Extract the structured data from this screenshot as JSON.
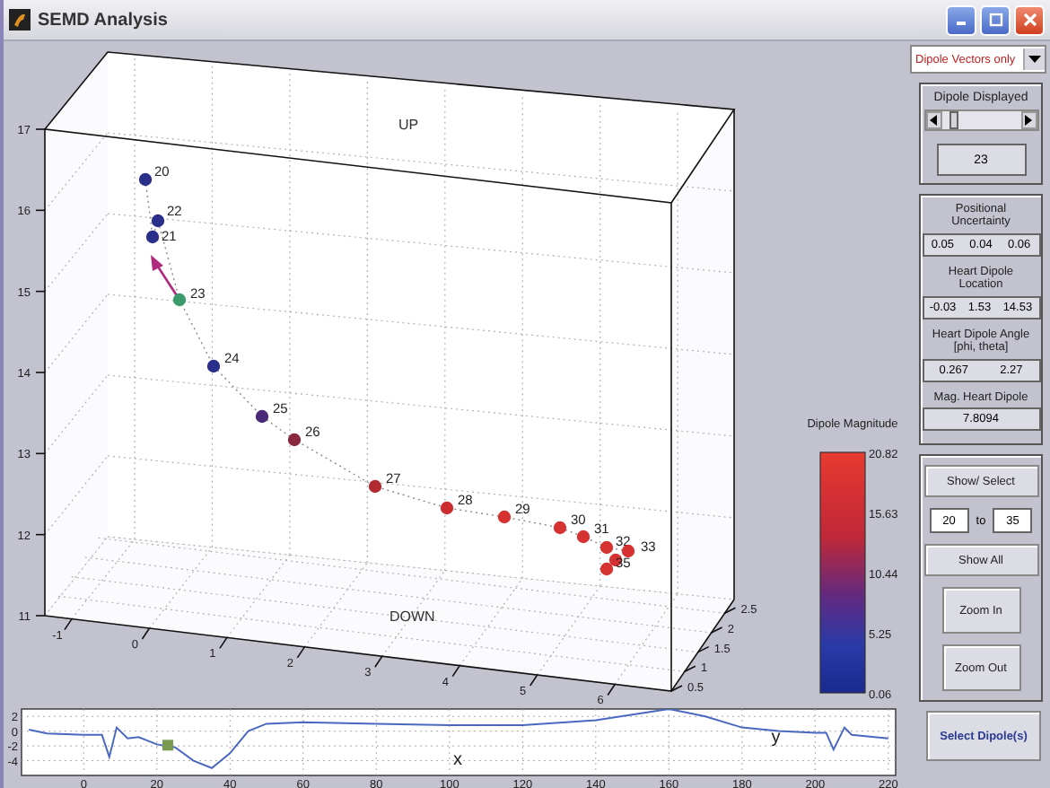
{
  "window": {
    "title": "SEMD Analysis"
  },
  "plot3d": {
    "top_label": "UP",
    "bottom_label": "DOWN",
    "z_ticks": [
      "17",
      "16",
      "15",
      "14",
      "13",
      "12",
      "11"
    ],
    "x_ticks": [
      "-1",
      "0",
      "1",
      "2",
      "3",
      "4",
      "5",
      "6"
    ],
    "y_ticks": [
      "2.5",
      "2",
      "1.5",
      "1",
      "0.5"
    ],
    "dipoles": [
      {
        "label": "20",
        "color": "#2b2f8c",
        "selected": false
      },
      {
        "label": "21",
        "color": "#2b2f8c",
        "selected": false
      },
      {
        "label": "22",
        "color": "#2b2f8c",
        "selected": false
      },
      {
        "label": "23",
        "color": "#3a9a6a",
        "selected": true
      },
      {
        "label": "24",
        "color": "#2b2f8c",
        "selected": false
      },
      {
        "label": "25",
        "color": "#4a2a78",
        "selected": false
      },
      {
        "label": "26",
        "color": "#8a2840",
        "selected": false
      },
      {
        "label": "27",
        "color": "#b02a30",
        "selected": false
      },
      {
        "label": "28",
        "color": "#cc2e30",
        "selected": false
      },
      {
        "label": "29",
        "color": "#d63232",
        "selected": false
      },
      {
        "label": "30",
        "color": "#d63232",
        "selected": false
      },
      {
        "label": "31",
        "color": "#d63232",
        "selected": false
      },
      {
        "label": "32",
        "color": "#d63232",
        "selected": false
      },
      {
        "label": "33",
        "color": "#d63232",
        "selected": false
      },
      {
        "color": "#d63232",
        "selected": false
      },
      {
        "label": "35",
        "color": "#d63232",
        "selected": false
      }
    ],
    "colorbar": {
      "title": "Dipole Magnitude",
      "ticks": [
        "20.82",
        "15.63",
        "10.44",
        "5.25",
        "0.06"
      ]
    }
  },
  "ecg": {
    "chart_data": {
      "type": "line",
      "x": [
        -15,
        -10,
        0,
        5,
        7,
        9,
        12,
        15,
        20,
        25,
        30,
        35,
        40,
        45,
        50,
        60,
        80,
        100,
        120,
        140,
        160,
        170,
        180,
        190,
        200,
        203,
        205,
        208,
        210,
        220
      ],
      "series": [
        {
          "color": "#4a68c0",
          "values": [
            0.2,
            -0.3,
            -0.5,
            -0.5,
            -3.5,
            0.5,
            -1,
            -0.8,
            -1.8,
            -2.2,
            -4,
            -5,
            -3,
            0,
            1,
            1.2,
            1,
            0.8,
            0.8,
            1.5,
            3,
            2,
            0.5,
            0,
            -0.2,
            -0.2,
            -2.5,
            0.5,
            -0.5,
            -1
          ]
        }
      ],
      "xlim": [
        -17,
        222
      ],
      "ylim": [
        -6,
        3
      ],
      "xticks": [
        0,
        20,
        40,
        60,
        80,
        100,
        120,
        140,
        160,
        180,
        200,
        220
      ],
      "yticks": [
        2,
        0,
        -2,
        -4
      ],
      "grid": true,
      "annotations": [
        "x",
        "y"
      ]
    }
  },
  "display_mode": {
    "value": "Dipole Vectors only"
  },
  "dipole_displayed": {
    "title": "Dipole Displayed",
    "value": "23"
  },
  "info": [
    {
      "label": "Positional Uncertainty",
      "values": [
        "0.05",
        "0.04",
        "0.06"
      ]
    },
    {
      "label": "Heart Dipole Location",
      "values": [
        "-0.03",
        "1.53",
        "14.53"
      ]
    },
    {
      "label": "Heart Dipole Angle [phi, theta]",
      "values": [
        "0.267",
        "2.27"
      ]
    },
    {
      "label": "Mag. Heart Dipole",
      "values": [
        "7.8094"
      ]
    }
  ],
  "range": {
    "button": "Show/ Select",
    "from": "20",
    "to_label": "to",
    "to": "35"
  },
  "buttons": [
    "Show All",
    "Zoom In",
    "Zoom Out"
  ],
  "select_button": "Select Dipole(s)"
}
